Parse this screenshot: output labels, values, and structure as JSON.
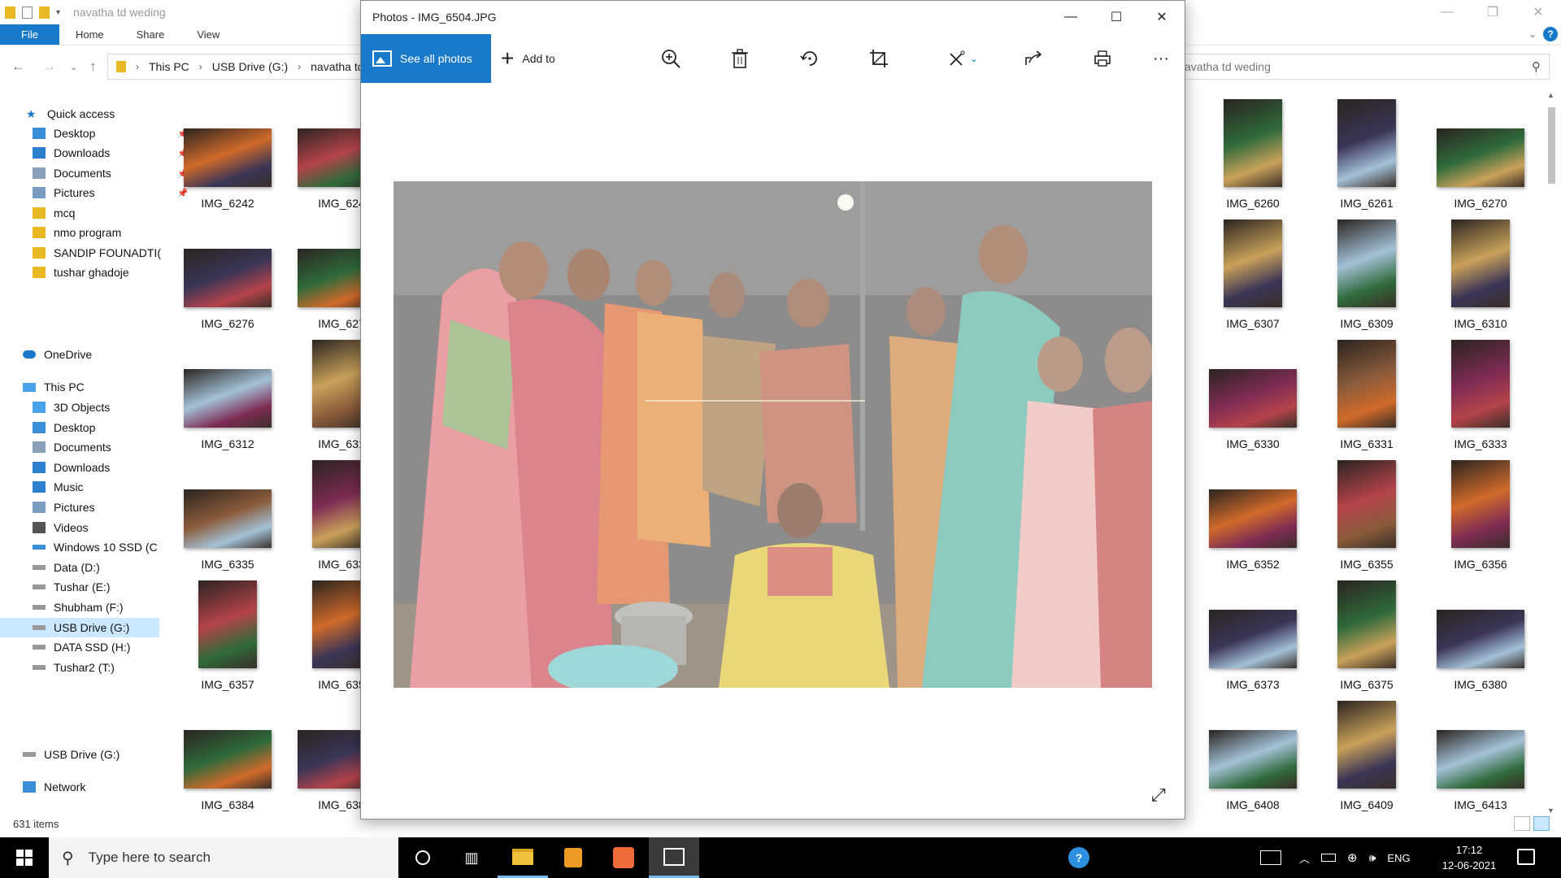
{
  "explorer": {
    "title": "navatha td weding",
    "ribbon_tabs": [
      "File",
      "Home",
      "Share",
      "View"
    ],
    "breadcrumb": [
      "This PC",
      "USB Drive (G:)",
      "navatha td"
    ],
    "search_placeholder": "avatha td weding",
    "item_count": "631 items",
    "nav": {
      "quick_access": "Quick access",
      "qa_items": [
        "Desktop",
        "Downloads",
        "Documents",
        "Pictures",
        "mcq",
        "nmo program",
        "SANDIP FOUNADTI(",
        "tushar ghadoje"
      ],
      "onedrive": "OneDrive",
      "this_pc": "This PC",
      "pc_items": [
        "3D Objects",
        "Desktop",
        "Documents",
        "Downloads",
        "Music",
        "Pictures",
        "Videos",
        "Windows 10 SSD (C",
        "Data (D:)",
        "Tushar (E:)",
        "Shubham (F:)",
        "USB Drive (G:)",
        "DATA SSD (H:)",
        "Tushar2 (T:)"
      ],
      "usb": "USB Drive (G:)",
      "network": "Network"
    },
    "left_col1": [
      "IMG_6242",
      "IMG_6276",
      "IMG_6312",
      "IMG_6335",
      "IMG_6357",
      "IMG_6384"
    ],
    "left_col2": [
      "IMG_624",
      "IMG_627",
      "IMG_631",
      "IMG_633",
      "IMG_635",
      "IMG_638"
    ],
    "right_col1": [
      "IMG_6260",
      "IMG_6307",
      "IMG_6330",
      "IMG_6352",
      "IMG_6373",
      "IMG_6408"
    ],
    "right_col2": [
      "IMG_6261",
      "IMG_6309",
      "IMG_6331",
      "IMG_6355",
      "IMG_6375",
      "IMG_6409"
    ],
    "right_col3": [
      "IMG_6270",
      "IMG_6310",
      "IMG_6333",
      "IMG_6356",
      "IMG_6380",
      "IMG_6413"
    ]
  },
  "photos": {
    "title": "Photos - IMG_6504.JPG",
    "see_all": "See all photos",
    "add_to": "Add to",
    "toolbar_icons": [
      "zoom-in-icon",
      "delete-icon",
      "rotate-icon",
      "crop-icon",
      "edit-icon",
      "share-icon",
      "print-icon",
      "more-icon"
    ]
  },
  "taskbar": {
    "search_placeholder": "Type here to search",
    "lang": "ENG",
    "time": "17:12",
    "date": "12-06-2021"
  },
  "colors": {
    "accent": "#1979ca",
    "selection": "#cce8ff"
  }
}
